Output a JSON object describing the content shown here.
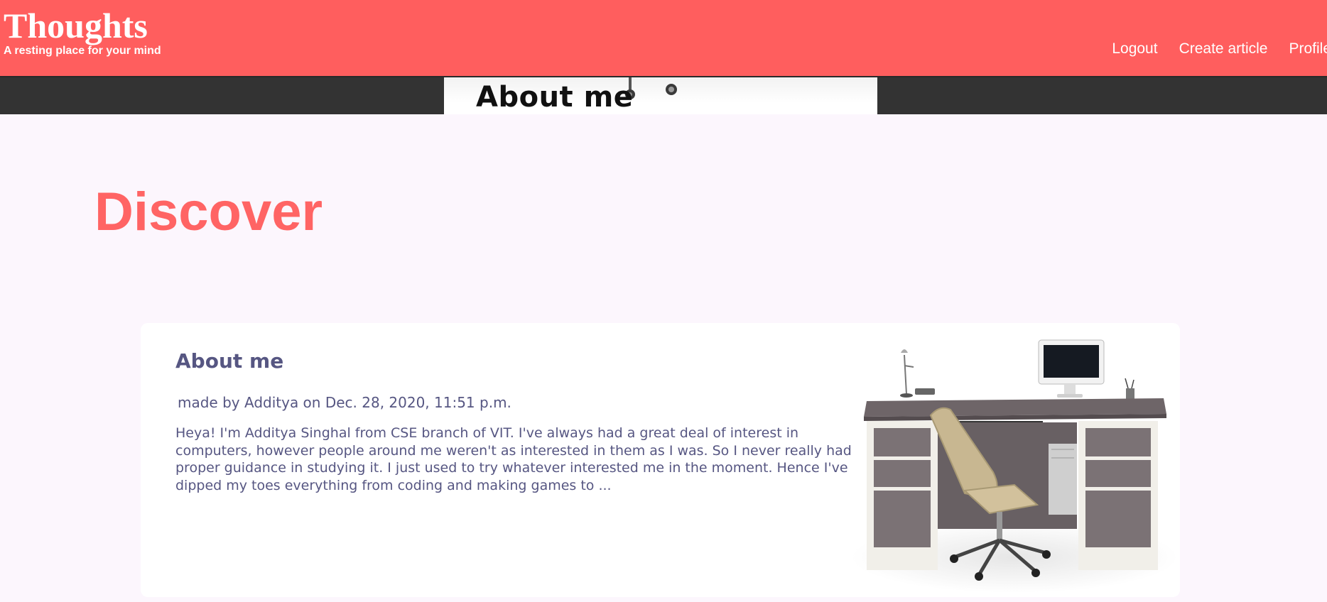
{
  "header": {
    "title": "Thoughts",
    "tagline": "A resting place for your mind",
    "nav": [
      {
        "label": "Logout"
      },
      {
        "label": "Create article"
      },
      {
        "label": "Profile"
      }
    ]
  },
  "hero": {
    "title": "About me"
  },
  "main": {
    "heading": "Discover",
    "articles": [
      {
        "title": "About me",
        "meta": "made by Additya on Dec. 28, 2020, 11:51 p.m.",
        "excerpt": "Heya! I'm Additya Singhal from CSE branch of VIT. I've always had a great deal of interest in computers, however people around me weren't as interested in them as I was. So I never really had proper guidance in studying it. I just used to try whatever interested me in the moment. Hence I've dipped my toes everything from coding and making games to ...",
        "image": "office-desk-with-chair-image"
      }
    ]
  },
  "colors": {
    "header_bg": "#ff5e5e",
    "accent": "#ff6464",
    "page_bg": "#fcf6fd",
    "strip_bg": "#333333",
    "article_text": "#565682"
  }
}
